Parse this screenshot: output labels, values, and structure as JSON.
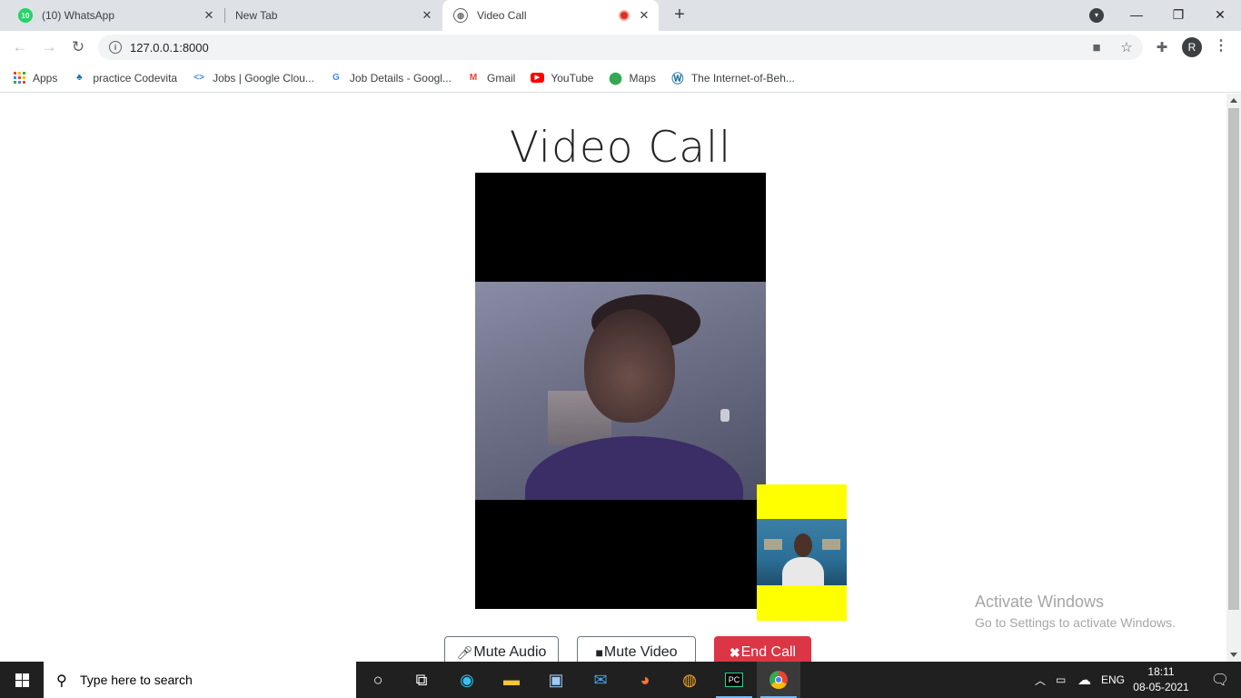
{
  "browser": {
    "tabs": [
      {
        "title": "(10) WhatsApp",
        "badge": "10",
        "icon": "whatsapp-icon"
      },
      {
        "title": "New Tab",
        "icon": ""
      },
      {
        "title": "Video Call",
        "icon": "globe-icon",
        "recording": true
      }
    ],
    "url": "127.0.0.1:8000",
    "profile_initial": "R",
    "bookmarks": [
      {
        "label": "Apps",
        "icon": "apps-grid-icon"
      },
      {
        "label": "practice Codevita",
        "icon": "codevita-icon"
      },
      {
        "label": "Jobs | Google Clou...",
        "icon": "google-cloud-icon"
      },
      {
        "label": "Job Details - Googl...",
        "icon": "google-icon"
      },
      {
        "label": "Gmail",
        "icon": "gmail-icon"
      },
      {
        "label": "YouTube",
        "icon": "youtube-icon"
      },
      {
        "label": "Maps",
        "icon": "maps-icon"
      },
      {
        "label": "The Internet-of-Beh...",
        "icon": "wordpress-icon"
      }
    ]
  },
  "page": {
    "title": "Video Call",
    "buttons": {
      "mute_audio": "Mute Audio",
      "mute_video": "Mute Video",
      "end_call": "End Call"
    },
    "colors": {
      "local_video_bg": "#ffff00",
      "remote_video_bg": "#000000",
      "end_call": "#dc3545"
    }
  },
  "watermark": {
    "line1": "Activate Windows",
    "line2": "Go to Settings to activate Windows."
  },
  "taskbar": {
    "search_placeholder": "Type here to search",
    "language": "ENG",
    "time": "18:11",
    "date": "08-05-2021"
  }
}
